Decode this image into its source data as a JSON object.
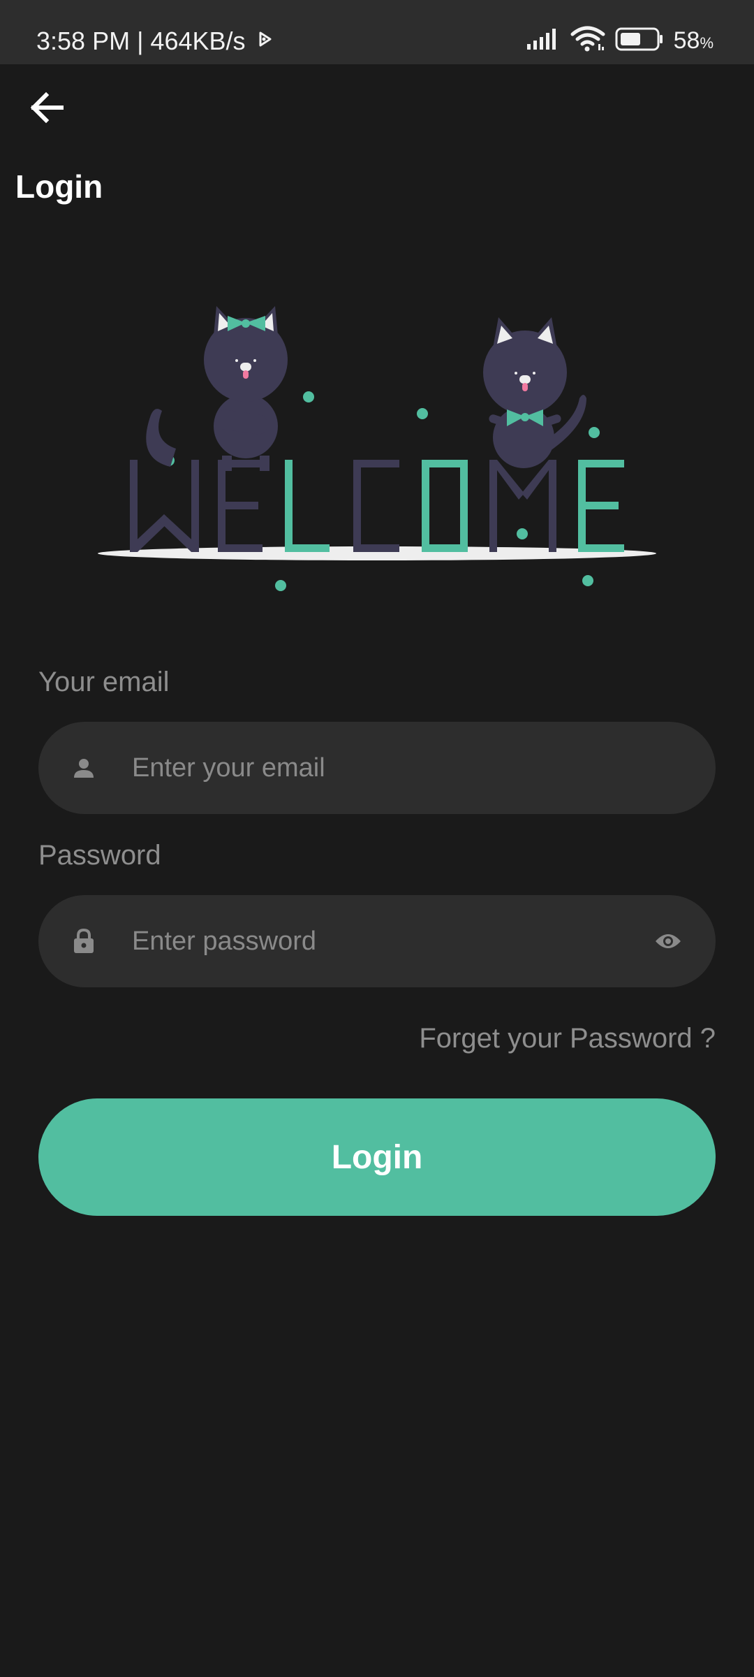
{
  "status_bar": {
    "time_speed": "3:58 PM | 464KB/s",
    "battery_value": "58",
    "battery_unit": "%",
    "battery_level": 0.58,
    "icons": [
      "play-icon",
      "signal-icon",
      "wifi-icon",
      "battery-icon"
    ]
  },
  "header": {
    "back_icon": "arrow-left-icon",
    "title": "Login"
  },
  "illustration": {
    "word": "WELCOME",
    "accent_color": "#52bea0",
    "cat_color": "#3e3b54"
  },
  "form": {
    "email_label": "Your email",
    "email_placeholder": "Enter your email",
    "email_value": "",
    "email_icon": "person-icon",
    "password_label": "Password",
    "password_placeholder": "Enter password",
    "password_value": "",
    "password_icon": "lock-icon",
    "visibility_icon": "eye-icon",
    "forgot_label": "Forget your Password ?",
    "login_label": "Login"
  },
  "colors": {
    "background": "#1a1a1a",
    "field": "#2d2d2d",
    "accent": "#52bea0",
    "muted_text": "#8e8e8e"
  }
}
